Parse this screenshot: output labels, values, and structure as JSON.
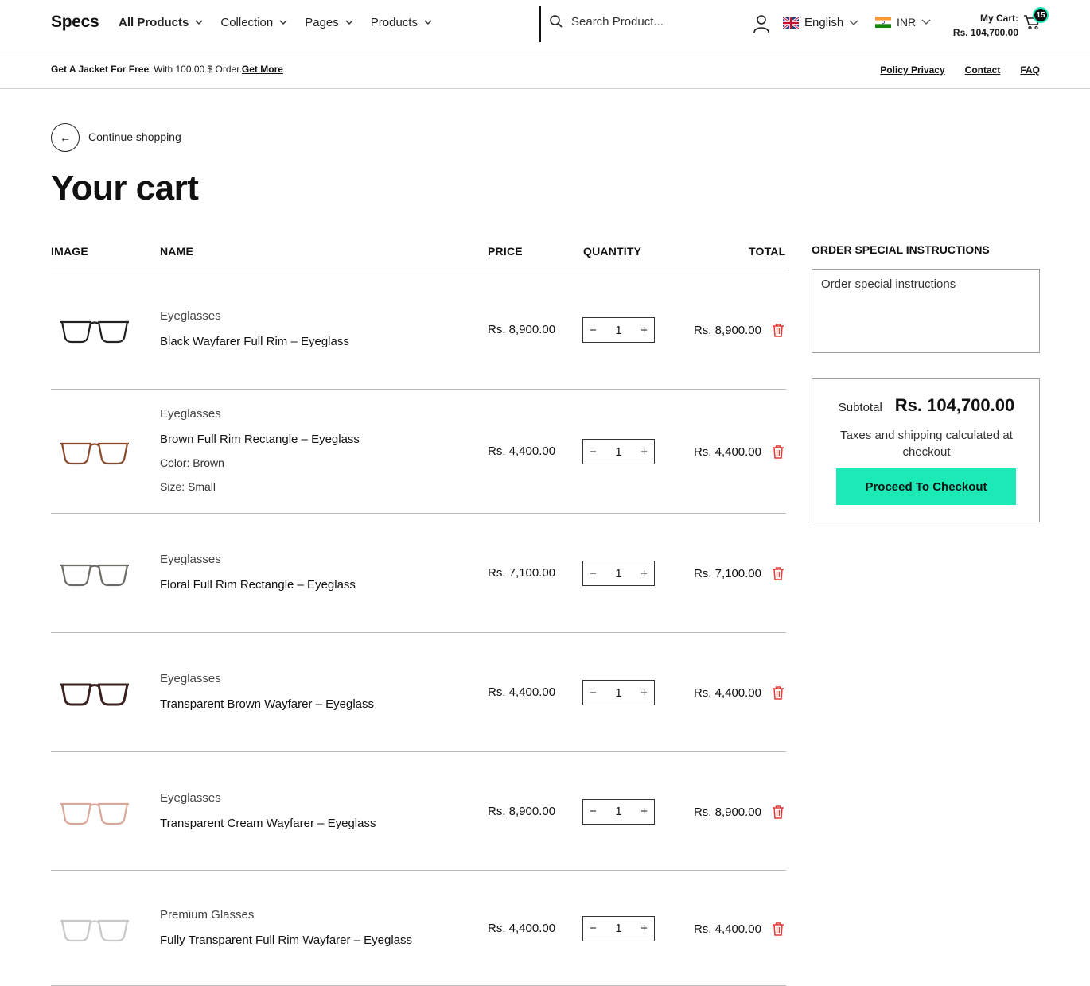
{
  "header": {
    "logo": "Specs",
    "nav": [
      {
        "label": "All Products",
        "bold": true
      },
      {
        "label": "Collection",
        "bold": false
      },
      {
        "label": "Pages",
        "bold": false
      },
      {
        "label": "Products",
        "bold": false
      }
    ],
    "search_placeholder": "Search Product...",
    "language": "English",
    "currency": "INR",
    "cart_label": "My Cart:",
    "cart_amount": "Rs. 104,700.00",
    "cart_count": "15"
  },
  "announcement": {
    "bold_text": "Get A Jacket For Free",
    "text": "With 100.00 $ Order.",
    "link": "Get More",
    "right_links": [
      "Policy Privacy",
      "Contact",
      "FAQ"
    ]
  },
  "continue_shopping": "Continue shopping",
  "page_title": "Your cart",
  "columns": {
    "image": "IMAGE",
    "name": "NAME",
    "price": "PRICE",
    "quantity": "QUANTITY",
    "total": "TOTAL"
  },
  "items": [
    {
      "type": "Eyeglasses",
      "name": "Black Wayfarer Full Rim – Eyeglass",
      "price": "Rs. 8,900.00",
      "qty": "1",
      "total": "Rs. 8,900.00",
      "frame_color": "#222222",
      "options": []
    },
    {
      "type": "Eyeglasses",
      "name": "Brown Full Rim Rectangle – Eyeglass",
      "price": "Rs. 4,400.00",
      "qty": "1",
      "total": "Rs. 4,400.00",
      "frame_color": "#8a4a2a",
      "options": [
        {
          "label": "Color:",
          "value": "Brown"
        },
        {
          "label": "Size:",
          "value": "Small"
        }
      ]
    },
    {
      "type": "Eyeglasses",
      "name": "Floral Full Rim Rectangle – Eyeglass",
      "price": "Rs. 7,100.00",
      "qty": "1",
      "total": "Rs. 7,100.00",
      "frame_color": "#6e6a66",
      "options": []
    },
    {
      "type": "Eyeglasses",
      "name": "Transparent Brown Wayfarer – Eyeglass",
      "price": "Rs. 4,400.00",
      "qty": "1",
      "total": "Rs. 4,400.00",
      "frame_color": "#3b2320",
      "options": []
    },
    {
      "type": "Eyeglasses",
      "name": "Transparent Cream Wayfarer – Eyeglass",
      "price": "Rs. 8,900.00",
      "qty": "1",
      "total": "Rs. 8,900.00",
      "frame_color": "#d9a898",
      "options": []
    },
    {
      "type": "Premium Glasses",
      "name": "Fully Transparent Full Rim Wayfarer – Eyeglass",
      "price": "Rs. 4,400.00",
      "qty": "1",
      "total": "Rs. 4,400.00",
      "frame_color": "#c8c8c8",
      "options": []
    }
  ],
  "instructions": {
    "label": "ORDER SPECIAL INSTRUCTIONS",
    "placeholder": "Order special instructions"
  },
  "summary": {
    "subtotal_label": "Subtotal",
    "subtotal_value": "Rs. 104,700.00",
    "tax_note": "Taxes and shipping calculated at checkout",
    "checkout_label": "Proceed To Checkout"
  },
  "colors": {
    "accent": "#1de9b6",
    "delete": "#e53935"
  }
}
